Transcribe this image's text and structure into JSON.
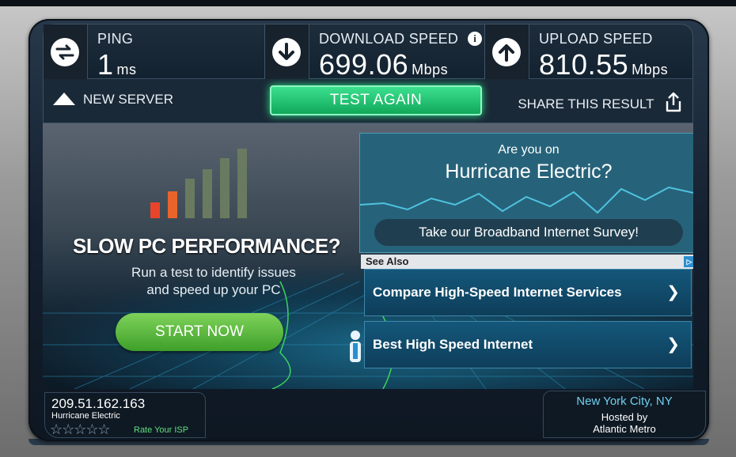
{
  "stats": {
    "ping": {
      "label": "PING",
      "value": "1",
      "unit": "ms",
      "icon": "ping-arrows-icon"
    },
    "download": {
      "label": "DOWNLOAD SPEED",
      "value": "699.06",
      "unit": "Mbps",
      "icon": "download-arrow-icon",
      "info": "i"
    },
    "upload": {
      "label": "UPLOAD SPEED",
      "value": "810.55",
      "unit": "Mbps",
      "icon": "upload-arrow-icon"
    }
  },
  "actions": {
    "new_server": "NEW SERVER",
    "test_again": "TEST AGAIN",
    "share": "SHARE THIS RESULT"
  },
  "ad_left": {
    "title": "SLOW PC PERFORMANCE?",
    "subtitle_line1": "Run a test to identify issues",
    "subtitle_line2": "and speed up your PC",
    "button": "START NOW"
  },
  "ad_right": {
    "question": "Are you on",
    "isp_name": "Hurricane Electric?",
    "survey_button": "Take our Broadband Internet Survey!"
  },
  "see_also": {
    "label": "See Also",
    "links": [
      {
        "text": "Compare High-Speed Internet Services"
      },
      {
        "text": "Best High Speed Internet"
      }
    ]
  },
  "client": {
    "ip": "209.51.162.163",
    "isp": "Hurricane Electric",
    "rate_label": "Rate Your ISP",
    "stars": "☆☆☆☆☆"
  },
  "server": {
    "location": "New York City, NY",
    "hosted_by": "Hosted by",
    "host": "Atlantic Metro"
  },
  "colors": {
    "accent_green": "#2de88a",
    "start_green": "#5cbf3a",
    "link_blue": "#14577a",
    "location_blue": "#6fd0f0"
  }
}
